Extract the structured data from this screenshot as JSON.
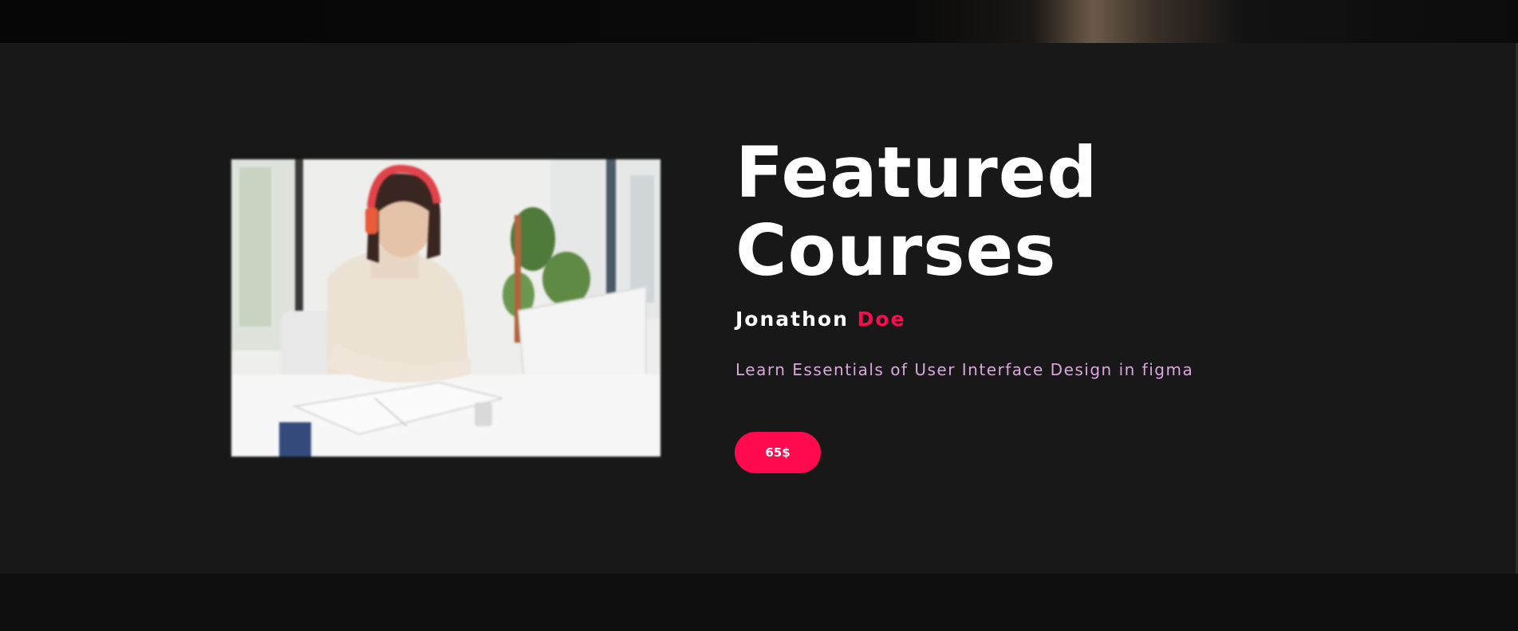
{
  "section": {
    "title_line1": "Featured",
    "title_line2": "Courses",
    "author_first": "Jonathon",
    "author_last": "Doe",
    "description": "Learn Essentials of User Interface Design in figma",
    "price_label": "65$"
  },
  "colors": {
    "accent": "#ff0a4e",
    "background": "#181818",
    "description": "#d9a7dc"
  },
  "image": {
    "icon": "course-photo-woman-laptop-headphones"
  }
}
